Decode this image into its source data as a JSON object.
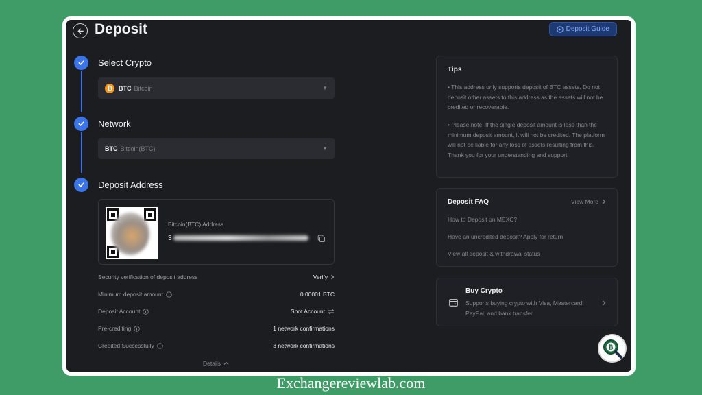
{
  "header": {
    "title": "Deposit",
    "guide_label": "Deposit Guide"
  },
  "steps": [
    {
      "title": "Select Crypto",
      "status": "complete"
    },
    {
      "title": "Network",
      "status": "complete"
    },
    {
      "title": "Deposit Address",
      "status": "complete"
    }
  ],
  "crypto_select": {
    "symbol": "BTC",
    "name": "Bitcoin",
    "coin_glyph": "₿"
  },
  "network_select": {
    "symbol": "BTC",
    "name": "Bitcoin(BTC)"
  },
  "address": {
    "label": "Bitcoin(BTC) Address",
    "visible_prefix": "3"
  },
  "info_rows": [
    {
      "label": "Security verification of deposit address",
      "value": "Verify"
    },
    {
      "label": "Minimum deposit amount",
      "value": "0.00001 BTC"
    },
    {
      "label": "Deposit Account",
      "value": "Spot Account"
    },
    {
      "label": "Pre-crediting",
      "value": "1 network confirmations"
    },
    {
      "label": "Credited Successfully",
      "value": "3 network confirmations"
    }
  ],
  "details_label": "Details",
  "tips": {
    "title": "Tips",
    "paragraphs": [
      "• This address only supports deposit of BTC assets. Do not deposit other assets to this address as the assets will not be credited or recoverable.",
      "• Please note: If the single deposit amount is less than the minimum deposit amount, it will not be credited. The platform will not be liable for any loss of assets resulting from this. Thank you for your understanding and support!"
    ]
  },
  "faq": {
    "title": "Deposit FAQ",
    "view_more": "View More",
    "links": [
      "How to Deposit on MEXC?",
      "Have an uncredited deposit? Apply for return",
      "View all deposit & withdrawal status"
    ]
  },
  "buy_crypto": {
    "title": "Buy Crypto",
    "description": "Supports buying crypto with Visa, Mastercard, PayPal, and bank transfer"
  },
  "footer": {
    "watermark": "Exchangereviewlab.com"
  },
  "colors": {
    "accent": "#3b74e6",
    "background": "#1c1d21",
    "page_border": "#3f9c67",
    "bitcoin": "#f7931a"
  }
}
